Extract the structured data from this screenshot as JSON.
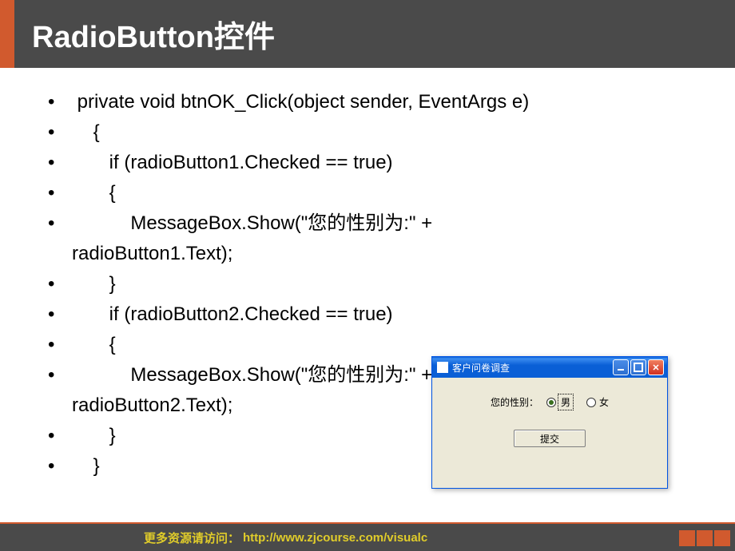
{
  "header": {
    "title": "RadioButton控件"
  },
  "code": {
    "lines": [
      " private void btnOK_Click(object sender, EventArgs e)",
      "    {",
      "       if (radioButton1.Checked == true)",
      "       {",
      "           MessageBox.Show(\"您的性别为:\" + ",
      "radioButton1.Text);",
      "       }",
      "       if (radioButton2.Checked == true)",
      "       {",
      "           MessageBox.Show(\"您的性别为:\" + ",
      "radioButton2.Text);",
      "       }",
      "    }"
    ],
    "no_bullet_indices": [
      5,
      10
    ]
  },
  "dialog": {
    "title": "客户问卷调查",
    "label": "您的性别：",
    "radio1": "男",
    "radio2": "女",
    "submit": "提交"
  },
  "footer": {
    "label": "更多资源请访问：",
    "link": "http://www.zjcourse.com/visualc"
  }
}
